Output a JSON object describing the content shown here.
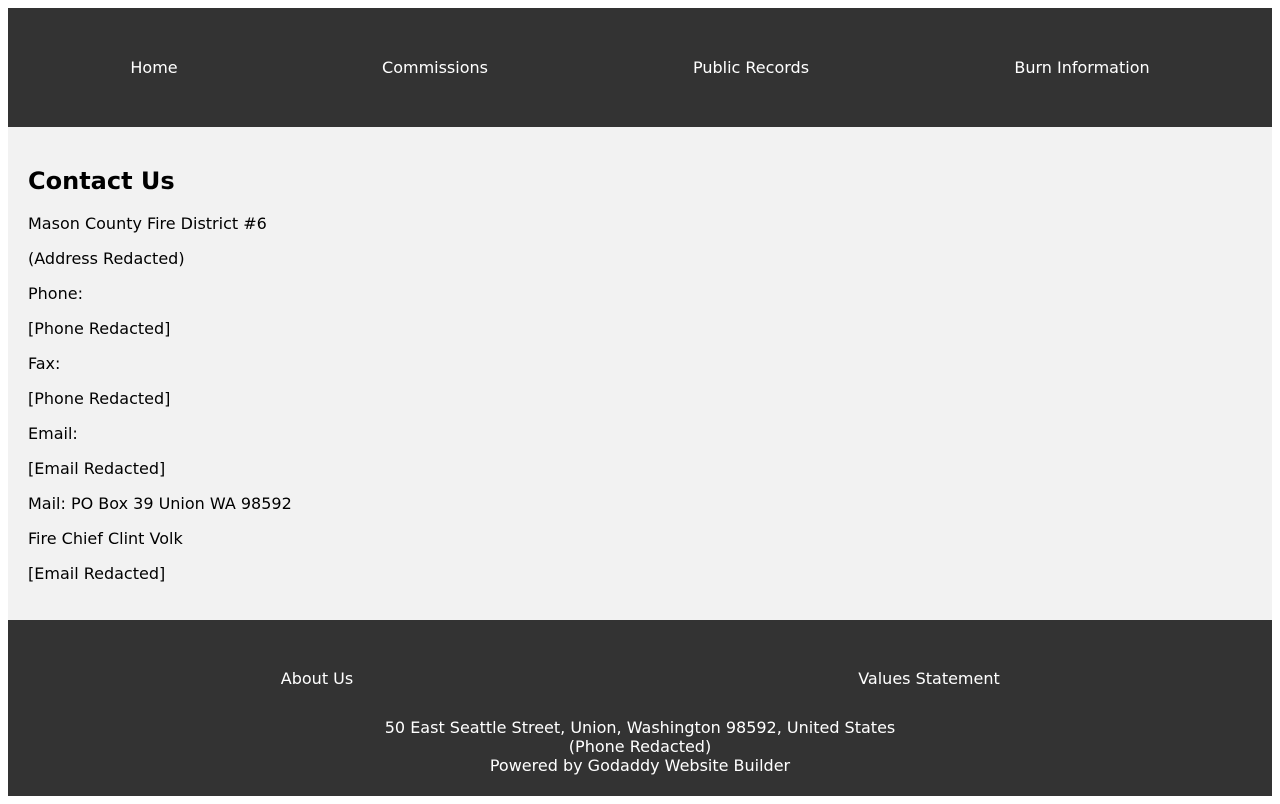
{
  "nav": {
    "items": [
      {
        "label": "Home"
      },
      {
        "label": "Commissions"
      },
      {
        "label": "Public Records"
      },
      {
        "label": "Burn Information"
      }
    ]
  },
  "contact": {
    "title": "Contact Us",
    "lines": [
      "Mason County Fire District #6",
      "(Address Redacted)",
      "Phone:",
      "[Phone Redacted]",
      "Fax:",
      "[Phone Redacted]",
      "Email:",
      "[Email Redacted]",
      "Mail: PO Box 39 Union WA 98592",
      "Fire Chief Clint Volk",
      "[Email Redacted]"
    ]
  },
  "footer": {
    "links": [
      {
        "label": "About Us"
      },
      {
        "label": "Values Statement"
      }
    ],
    "address": "50 East Seattle Street, Union, Washington 98592, United States",
    "phone": "(Phone Redacted)",
    "powered_by": "Powered by Godaddy Website Builder"
  },
  "colors": {
    "header_bg": "#333333",
    "content_bg": "#f2f2f2",
    "footer_bg": "#333333",
    "nav_text": "#ffffff"
  }
}
